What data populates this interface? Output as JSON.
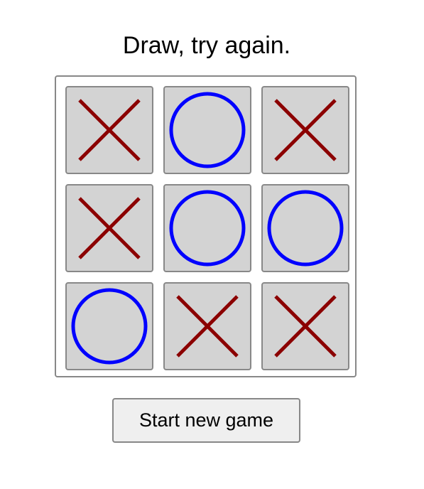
{
  "status_text": "Draw, try again.",
  "new_game_label": "Start new game",
  "colors": {
    "x_mark": "#8b0000",
    "o_mark": "#0000ff",
    "cell_fill": "#d3d3d3",
    "border": "#888888"
  },
  "board": [
    [
      "X",
      "O",
      "X"
    ],
    [
      "X",
      "O",
      "O"
    ],
    [
      "O",
      "X",
      "X"
    ]
  ]
}
